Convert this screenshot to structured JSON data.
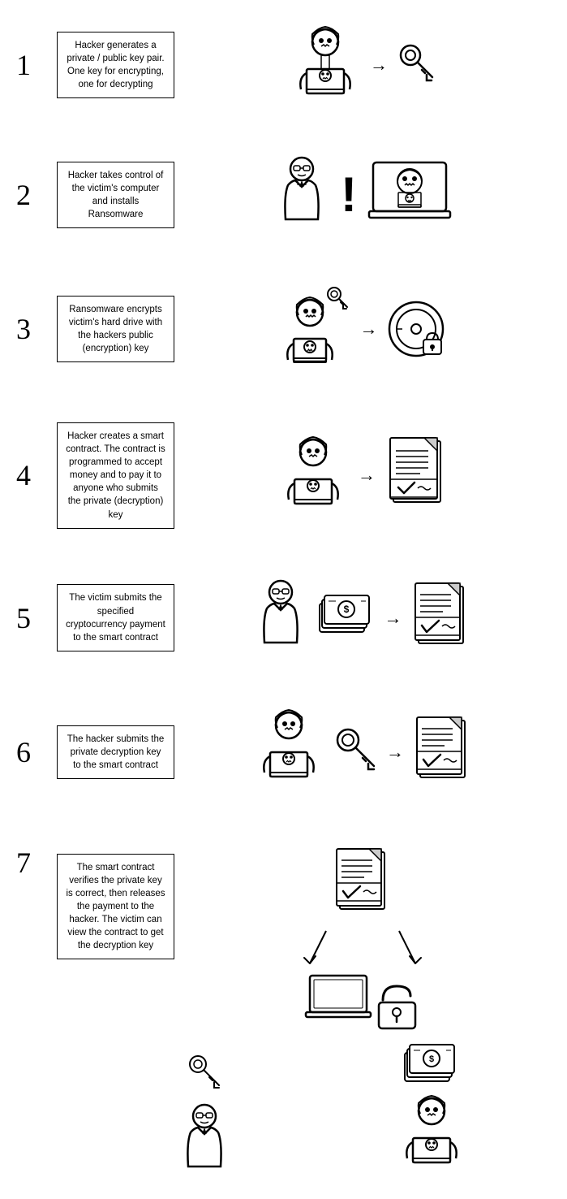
{
  "steps": [
    {
      "number": "1",
      "text": "Hacker generates a private / public key pair. One key for encrypting, one for decrypting"
    },
    {
      "number": "2",
      "text": "Hacker takes control of the victim's computer and installs Ransomware"
    },
    {
      "number": "3",
      "text": "Ransomware encrypts victim's hard drive with the hackers public (encryption) key"
    },
    {
      "number": "4",
      "text": "Hacker creates a smart contract. The contract is programmed to accept money and to pay it to anyone who submits the private (decryption) key"
    },
    {
      "number": "5",
      "text": "The victim submits the specified cryptocurrency payment to the smart contract"
    },
    {
      "number": "6",
      "text": "The hacker submits the private decryption key to the smart contract"
    },
    {
      "number": "7",
      "text": "The smart contract verifies the private key is correct, then releases the payment to the hacker. The victim can view the contract to get the decryption key"
    }
  ]
}
